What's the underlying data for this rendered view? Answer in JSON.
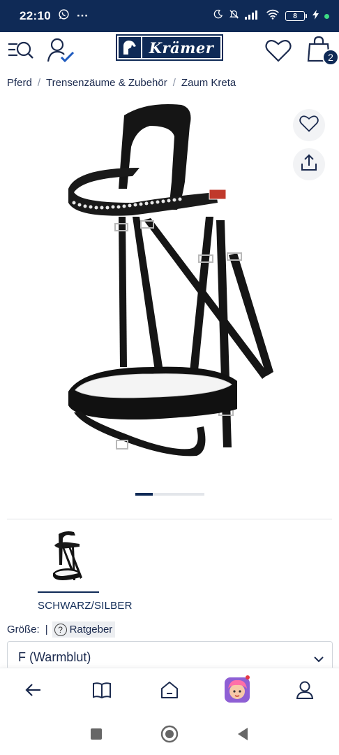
{
  "status_bar": {
    "time": "22:10",
    "more": "···",
    "battery_level": "8"
  },
  "header": {
    "brand": "Krämer",
    "cart_count": "2"
  },
  "breadcrumb": {
    "items": [
      "Pferd",
      "Trensenzäume & Zubehör",
      "Zaum Kreta"
    ],
    "separator": "/"
  },
  "gallery": {
    "slides_total": 4,
    "active_slide": 1
  },
  "variant": {
    "label": "SCHWARZ/SILBER"
  },
  "size": {
    "label": "Größe:",
    "separator": "|",
    "advisor_icon_text": "?",
    "advisor_label": "Ratgeber",
    "selected": "F (Warmblut)"
  },
  "bottom_nav": {
    "icons": [
      "back-arrow-icon",
      "book-icon",
      "home-icon",
      "game-icon",
      "profile-icon"
    ]
  },
  "colors": {
    "primary": "#0f2a56",
    "text": "#1b2a4e",
    "notification": "#e53945"
  }
}
